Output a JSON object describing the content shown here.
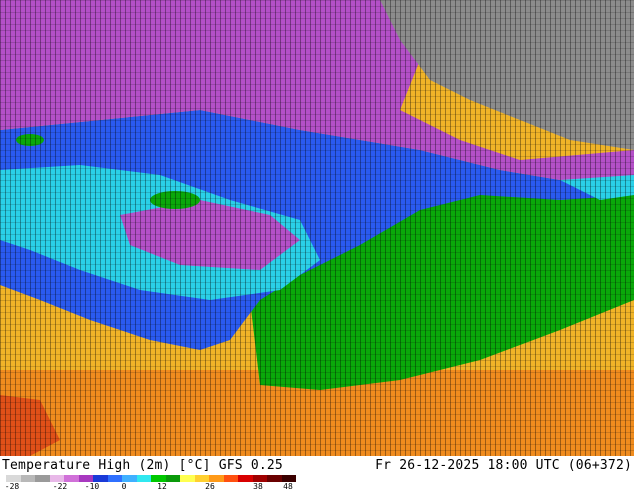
{
  "footer": {
    "title": "Temperature High (2m) [°C] GFS 0.25",
    "datetime": "Fr 26-12-2025 18:00 UTC (06+372)"
  },
  "scale": {
    "ticks": [
      "-28",
      "-22",
      "-10",
      "0",
      "12",
      "26",
      "38",
      "48"
    ],
    "colors": [
      "#d9d9d9",
      "#b8b8b8",
      "#9a9a9a",
      "#e8b8e8",
      "#d070d8",
      "#a838c0",
      "#1a3ad8",
      "#2f70ff",
      "#3fb0ff",
      "#30e8f0",
      "#00c800",
      "#0a9a0a",
      "#ffff50",
      "#ffd030",
      "#ff9a18",
      "#ff5010",
      "#d80000",
      "#a00000",
      "#6a0000",
      "#3a0000"
    ]
  },
  "colors": {
    "arctic": "#8c8c8c",
    "purple": "#b450c8",
    "blue": "#2a5af0",
    "cyan": "#2ad0e8",
    "green": "#0aa80a",
    "warm": "#f0b428"
  }
}
